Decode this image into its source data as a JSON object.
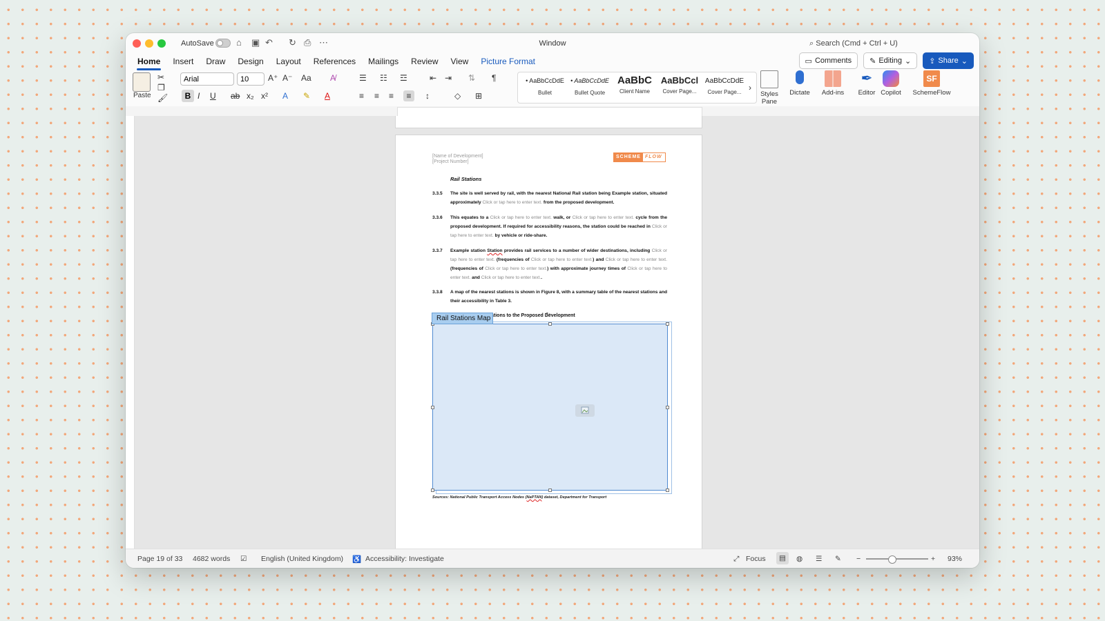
{
  "window": {
    "title": "Window",
    "autosave_label": "AutoSave",
    "search_placeholder": "Search (Cmd + Ctrl + U)"
  },
  "tabs": [
    {
      "label": "Home"
    },
    {
      "label": "Insert"
    },
    {
      "label": "Draw"
    },
    {
      "label": "Design"
    },
    {
      "label": "Layout"
    },
    {
      "label": "References"
    },
    {
      "label": "Mailings"
    },
    {
      "label": "Review"
    },
    {
      "label": "View"
    },
    {
      "label": "Picture Format"
    }
  ],
  "header_buttons": {
    "comments": "Comments",
    "editing": "Editing",
    "share": "Share"
  },
  "ribbon": {
    "paste_label": "Paste",
    "font": "Arial",
    "size": "10",
    "styles": [
      {
        "sample": "• AaBbCcDdE",
        "name": "Bullet"
      },
      {
        "sample": "• AaBbCcDdE",
        "name": "Bullet Quote"
      },
      {
        "sample": "AaBbC",
        "name": "Client Name"
      },
      {
        "sample": "AaBbCcl",
        "name": "Cover Page..."
      },
      {
        "sample": "AaBbCcDdE",
        "name": "Cover Page..."
      }
    ],
    "styles_pane": "Styles Pane",
    "dictate": "Dictate",
    "addins": "Add-ins",
    "editor": "Editor",
    "copilot": "Copilot",
    "schemeflow": "SchemeFlow",
    "schemeflow_icon_text": "SF"
  },
  "document": {
    "header_line1": "[Name of Development]",
    "header_line2": "[Project Number]",
    "logo_part1": "SCHEME",
    "logo_part2": "FLOW",
    "section_title": "Rail Stations",
    "paragraphs": {
      "p1": {
        "num": "3.3.5",
        "a": "The site is well served by rail, with the nearest National Rail station being Example station, situated approximately ",
        "ph1": "Click or tap here to enter text.",
        "b": " from the proposed development."
      },
      "p2": {
        "num": "3.3.6",
        "a": "This equates to a ",
        "ph1": "Click or tap here to enter text.",
        "b": " walk, or ",
        "ph2": "Click or tap here to enter text.",
        "c": " cycle from the proposed development. If required for accessibility reasons, the station could be reached in ",
        "ph3": "Click or tap here to enter text.",
        "d": " by vehicle or ride-share."
      },
      "p3": {
        "num": "3.3.7",
        "a": "Example station ",
        "sq": "Station",
        "b": " provides rail services to a number of wider destinations, including ",
        "ph1": "Click or tap here to enter text.",
        "c": " (frequencies of ",
        "ph2": "Click or tap here to enter text.",
        "d": ") and ",
        "ph3": "Click or tap here to enter text.",
        "e": " (frequencies of ",
        "ph4": "Click or tap here to enter text.",
        "f": ") with approximate journey times of ",
        "ph5": "Click or tap here to enter text.",
        "g": " and ",
        "ph6": "Click or tap here to enter text.",
        "h": "."
      },
      "p4": {
        "num": "3.3.8",
        "a": "A map of the nearest stations is shown in ",
        "b": "Figure 8",
        "c": ", with a summary table of the nearest stations and their accessibility in ",
        "d": "Table 3",
        "e": "."
      }
    },
    "figure_caption": "ations to the Proposed Development",
    "content_control_tag": "Rail Stations Map",
    "sources_a": "Sources: National Public Transport Access Nodes (",
    "sources_sq": "NaPTAN",
    "sources_b": ") dataset, Department for Transport"
  },
  "status": {
    "page": "Page 19 of 33",
    "words": "4682 words",
    "language": "English (United Kingdom)",
    "accessibility": "Accessibility: Investigate",
    "focus": "Focus",
    "zoom": "93%",
    "zoom_minus": "−",
    "zoom_plus": "+"
  },
  "colors": {
    "accent": "#185abd",
    "brand_orange": "#f08a4b",
    "selection": "#a8cdef"
  },
  "icons": [
    "home-icon",
    "save-icon",
    "undo-icon",
    "redo-icon",
    "print-icon",
    "more-icon",
    "search-icon",
    "comment-icon",
    "pencil-icon",
    "share-icon",
    "microphone-icon",
    "image-icon",
    "focus-icon"
  ]
}
